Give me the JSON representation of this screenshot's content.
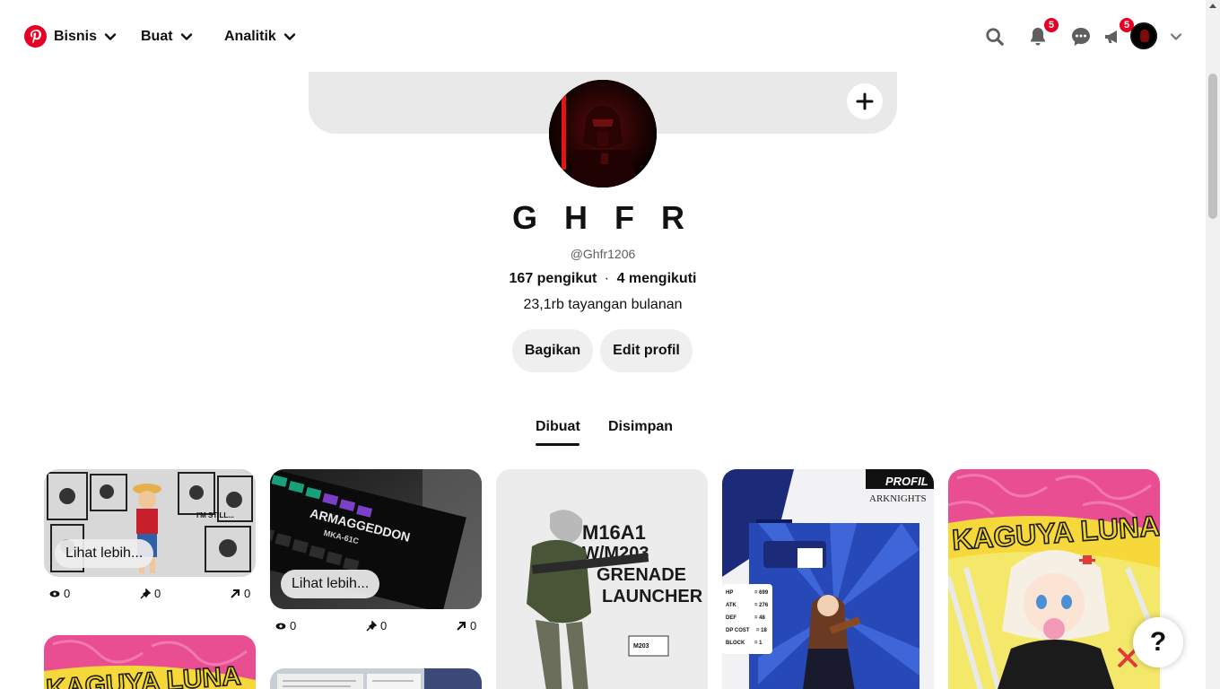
{
  "nav": {
    "business": "Bisnis",
    "create": "Buat",
    "analytics": "Analitik",
    "notifications_count": "5",
    "updates_count": "5"
  },
  "profile": {
    "name": "G H F R",
    "username": "@Ghfr1206",
    "followers": "167 pengikut",
    "following": "4 mengikuti",
    "separator": "·",
    "monthly_views": "23,1rb tayangan bulanan",
    "share_label": "Bagikan",
    "edit_label": "Edit profil"
  },
  "tabs": {
    "created": "Dibuat",
    "saved": "Disimpan"
  },
  "pins": [
    {
      "more_label": "Lihat lebih...",
      "views": "0",
      "saves": "0",
      "clicks": "0",
      "image_text": [
        "I'M STILL..."
      ]
    },
    {
      "more_label": "Lihat lebih...",
      "views": "0",
      "saves": "0",
      "clicks": "0",
      "image_text": [
        "ARMAGGEDDON",
        "MKA-61C"
      ]
    },
    {
      "image_text": [
        "M16A1",
        "W/M203",
        "GRENADE",
        "LAUNCHER",
        "M203"
      ]
    },
    {
      "image_text": [
        "PROFIL",
        "ARKNIGHTS",
        "HP",
        "ATK",
        "DEF",
        "DP COST",
        "BLOCK",
        "= 699",
        "= 276",
        "= 48",
        "= 18",
        "= 1"
      ]
    },
    {
      "image_text": [
        "KAGUYA LUNA"
      ]
    }
  ],
  "help_label": "?",
  "colors": {
    "brand": "#e60023",
    "button_bg": "#efefef",
    "cover_bg": "#e9e9e9"
  }
}
